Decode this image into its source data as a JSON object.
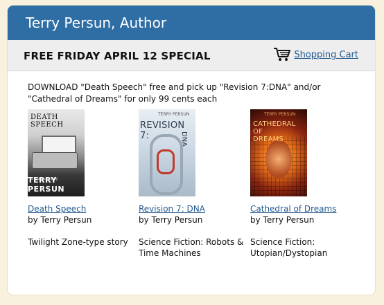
{
  "header": {
    "title": "Terry Persun, Author"
  },
  "subbar": {
    "special_label": "FREE FRIDAY APRIL 12 SPECIAL",
    "cart_label": "Shopping Cart"
  },
  "intro": "DOWNLOAD \"Death Speech\" free and pick up \"Revision 7:DNA\" and/or \"Cathedral of Dreams\" for only 99 cents each",
  "books": [
    {
      "title": "Death Speech",
      "author": "by Terry Persun",
      "description": "Twilight Zone-type story",
      "cover": {
        "title_line1": "DEATH",
        "title_line2": "SPEECH",
        "byline": "a short story by",
        "author": "TERRY PERSUN"
      }
    },
    {
      "title": "Revision 7: DNA",
      "author": "by Terry Persun",
      "description": "Science Fiction: Robots & Time Machines",
      "cover": {
        "author": "TERRY PERSUN",
        "title": "REVISION 7:",
        "subtitle": "DNA"
      }
    },
    {
      "title": "Cathedral of Dreams",
      "author": "by Terry Persun",
      "description": "Science Fiction: Utopian/Dystopian",
      "cover": {
        "author": "TERRY PERSUN",
        "title_line1": "CATHEDRAL OF",
        "title_line2": "DREAMS"
      }
    }
  ]
}
